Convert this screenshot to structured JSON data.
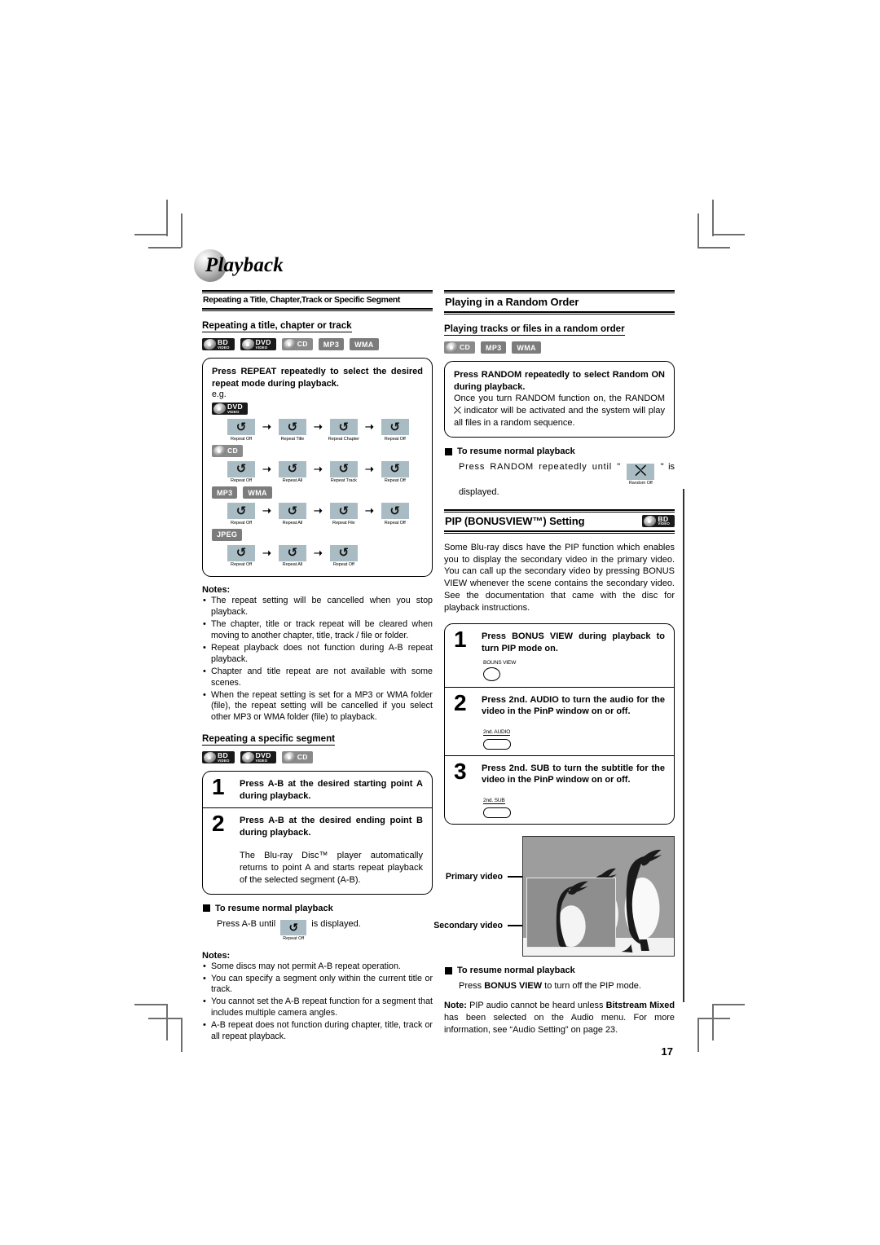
{
  "chapter": {
    "title": "Playback"
  },
  "left": {
    "section_heading": "Repeating a Title, Chapter,Track or Specific Segment",
    "sub1": "Repeating a title, chapter or track",
    "badges1": [
      {
        "type": "disc",
        "main": "BD",
        "sub": "VIDEO",
        "style": "dark"
      },
      {
        "type": "disc",
        "main": "DVD",
        "sub": "VIDEO",
        "style": "dark"
      },
      {
        "type": "disc",
        "main": "CD",
        "sub": "",
        "style": "mid"
      },
      {
        "type": "text",
        "main": "MP3",
        "style": "gray"
      },
      {
        "type": "text",
        "main": "WMA",
        "style": "gray"
      }
    ],
    "instruction1": "Press REPEAT repeatedly to select the desired repeat mode during playback.",
    "eg": "e.g.",
    "flows": [
      {
        "badges": [
          {
            "type": "disc",
            "main": "DVD",
            "sub": "VIDEO",
            "style": "dark"
          }
        ],
        "items": [
          "Repeat Off",
          "Repeat Title",
          "Repeat Chapter",
          "Repeat Off"
        ]
      },
      {
        "badges": [
          {
            "type": "disc",
            "main": "CD",
            "sub": "",
            "style": "mid"
          }
        ],
        "items": [
          "Repeat Off",
          "Repeat All",
          "Repeat Track",
          "Repeat Off"
        ]
      },
      {
        "badges": [
          {
            "type": "text",
            "main": "MP3",
            "style": "gray"
          },
          {
            "type": "text",
            "main": "WMA",
            "style": "gray"
          }
        ],
        "items": [
          "Repeat Off",
          "Repeat All",
          "Repeat File",
          "Repeat Off"
        ]
      },
      {
        "badges": [
          {
            "type": "text",
            "main": "JPEG",
            "style": "gray"
          }
        ],
        "items": [
          "Repeat Off",
          "Repeat All",
          "Repeat Off"
        ]
      }
    ],
    "notes_label": "Notes:",
    "notes1": [
      "The repeat setting will be cancelled when you stop playback.",
      "The chapter, title or track repeat will be cleared when moving to another chapter, title, track / file or folder.",
      "Repeat playback does not function during A-B repeat playback.",
      "Chapter and title repeat are not available with some scenes.",
      "When the repeat setting is set for a MP3 or WMA folder (file), the repeat setting will be cancelled if you select other MP3 or WMA folder (file) to playback."
    ],
    "sub2": "Repeating a specific segment",
    "badges2": [
      {
        "type": "disc",
        "main": "BD",
        "sub": "VIDEO",
        "style": "dark"
      },
      {
        "type": "disc",
        "main": "DVD",
        "sub": "VIDEO",
        "style": "dark"
      },
      {
        "type": "disc",
        "main": "CD",
        "sub": "",
        "style": "mid"
      }
    ],
    "steps": [
      {
        "num": "1",
        "text": "Press A-B at the desired starting point A during playback."
      },
      {
        "num": "2",
        "text": "Press A-B at the desired ending point B during playback."
      }
    ],
    "step2_cont": "The Blu-ray Disc™ player automatically returns to point A and starts repeat playback of the selected segment (A-B).",
    "resume_heading": "To resume normal playback",
    "resume_pre": "Press A-B until",
    "resume_icon_glyph": "↺",
    "resume_icon_label": "Repeat Off",
    "resume_post": "is displayed.",
    "notes2_label": "Notes:",
    "notes2": [
      "Some discs may not permit A-B repeat operation.",
      "You can specify a segment only within the current title or track.",
      "You cannot set the A-B repeat function for a segment that includes multiple camera angles.",
      "A-B repeat does not function during chapter, title, track or all repeat playback."
    ]
  },
  "right": {
    "section_heading": "Playing in a Random Order",
    "sub1": "Playing tracks or files in a random order",
    "badges1": [
      {
        "type": "disc",
        "main": "CD",
        "sub": "",
        "style": "mid"
      },
      {
        "type": "text",
        "main": "MP3",
        "style": "gray"
      },
      {
        "type": "text",
        "main": "WMA",
        "style": "gray"
      }
    ],
    "instruction1": "Press RANDOM repeatedly to select Random ON during playback.",
    "body1_a": "Once you turn RANDOM function on, the RANDOM",
    "body1_icon": "⤬",
    "body1_b": "indicator will be activated and the system will play all files in a random sequence.",
    "resume_heading": "To resume normal playback",
    "resume_pre": "Press RANDOM repeatedly until \"",
    "resume_icon_glyph": "⤬",
    "resume_icon_label": "Random Off",
    "resume_post": "\" is displayed.",
    "pip_heading": "PIP (BONUSVIEW™) Setting",
    "pip_badge": {
      "type": "disc",
      "main": "BD",
      "sub": "VIDEO",
      "style": "dark"
    },
    "pip_intro": "Some Blu-ray discs have the PIP function which enables you to display the secondary video in the primary video. You can call up the secondary video by pressing BONUS VIEW whenever the scene contains the secondary video. See the documentation that came with the disc for playback instructions.",
    "steps": [
      {
        "num": "1",
        "text": "Press BONUS VIEW during playback to turn PIP mode on.",
        "key": "BOUNS VIEW",
        "keyshape": "circle"
      },
      {
        "num": "2",
        "text": "Press 2nd. AUDIO to turn the audio for the video in the PinP window on or off.",
        "key": "2nd. AUDIO",
        "keyshape": "pill"
      },
      {
        "num": "3",
        "text": "Press 2nd. SUB to turn the subtitle for the video in the PinP window on or off.",
        "key": "2nd. SUB",
        "keyshape": "pill"
      }
    ],
    "figure": {
      "primary_label": "Primary video",
      "secondary_label": "Secondary video"
    },
    "resume2_heading": "To resume normal playback",
    "resume2_pre": "Press ",
    "resume2_bold": "BONUS VIEW",
    "resume2_post": " to turn off the PIP mode.",
    "note_label": "Note:",
    "note_a": " PIP audio cannot be heard unless ",
    "note_b1": "Bitstream Mixed",
    "note_c": " has been selected on the Audio menu. For more information, see “Audio Setting” on page 23."
  },
  "page_number": "17"
}
